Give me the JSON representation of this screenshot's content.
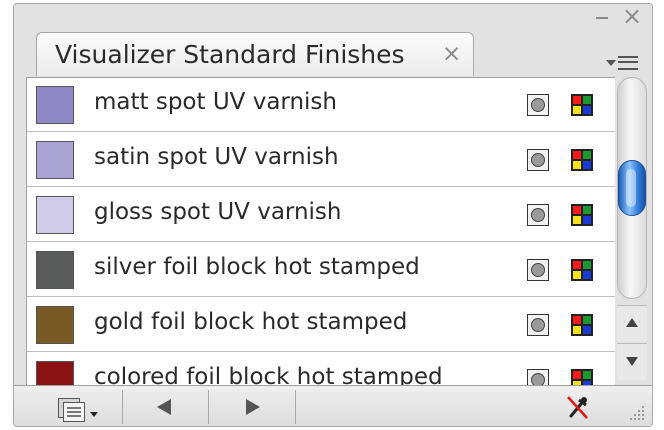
{
  "panel": {
    "tab_title": "Visualizer Standard Finishes",
    "tab_close_glyph": "×",
    "window_close_glyph": "×",
    "items": [
      {
        "label": "matt spot UV varnish",
        "swatch_color": "#8e88c4",
        "icons": [
          "spot-color-icon",
          "process-color-icon"
        ]
      },
      {
        "label": "satin spot UV varnish",
        "swatch_color": "#aaa5d4",
        "icons": [
          "spot-color-icon",
          "process-color-icon"
        ]
      },
      {
        "label": "gloss spot UV varnish",
        "swatch_color": "#d1cde9",
        "icons": [
          "spot-color-icon",
          "process-color-icon"
        ]
      },
      {
        "label": "silver foil block hot stamped",
        "swatch_color": "#5a5b5b",
        "icons": [
          "spot-color-icon",
          "process-color-icon"
        ]
      },
      {
        "label": "gold foil block hot stamped",
        "swatch_color": "#7a5a24",
        "icons": [
          "spot-color-icon",
          "process-color-icon"
        ]
      },
      {
        "label": "colored foil block hot stamped",
        "swatch_color": "#8a1212",
        "icons": [
          "spot-color-icon",
          "process-color-icon"
        ]
      }
    ],
    "scroll_position_fraction": 0.5,
    "toolbar_icons": [
      "swatch-options-icon",
      "previous-icon",
      "next-icon",
      "eyedropper-disabled-icon",
      "resize-grip-icon"
    ]
  },
  "colors": {
    "scroll_thumb": "#3b82e0",
    "process_icon_quadrants": [
      "#ff1a1a",
      "#1a9a2e",
      "#f4e21a",
      "#1a3ad6"
    ]
  }
}
